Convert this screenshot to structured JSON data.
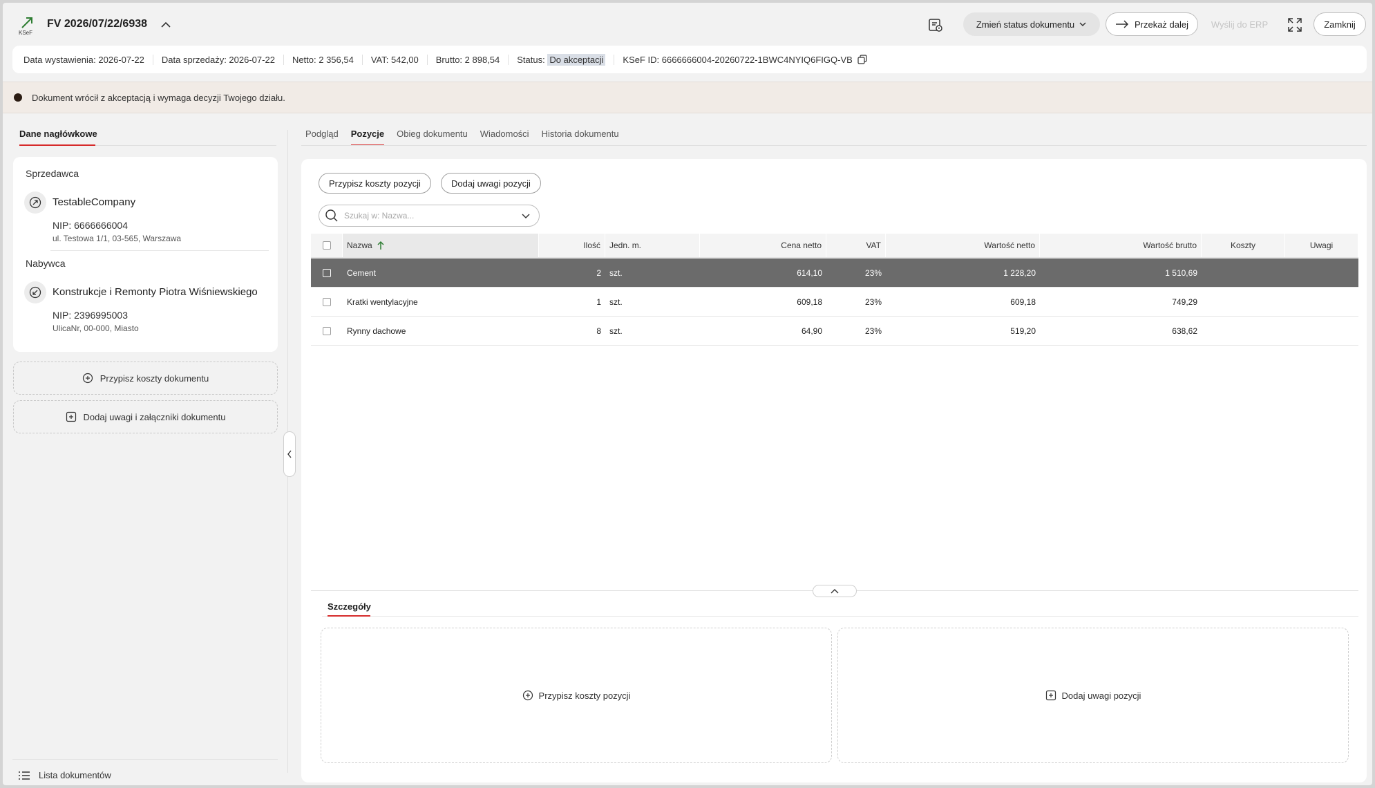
{
  "header": {
    "logo_text": "KSeF",
    "doc_title": "FV 2026/07/22/6938",
    "status_button": "Zmień status dokumentu",
    "forward_button": "Przekaż dalej",
    "erp_button": "Wyślij do ERP",
    "close_button": "Zamknij"
  },
  "info": {
    "issue_date": "Data wystawienia: 2026-07-22",
    "sale_date": "Data sprzedaży: 2026-07-22",
    "net": "Netto: 2 356,54",
    "vat": "VAT: 542,00",
    "gross": "Brutto: 2 898,54",
    "status_label": "Status:",
    "status_value": "Do akceptacji",
    "ksef_id": "KSeF ID: 6666666004-20260722-1BWC4NYIQ6FIGQ-VB"
  },
  "notice": "Dokument wrócił z akceptacją i wymaga decyzji Twojego działu.",
  "left": {
    "tab": "Dane nagłówkowe",
    "seller_label": "Sprzedawca",
    "seller_name": "TestableCompany",
    "seller_nip": "NIP: 6666666004",
    "seller_address": "ul. Testowa 1/1, 03-565, Warszawa",
    "buyer_label": "Nabywca",
    "buyer_name": "Konstrukcje i Remonty Piotra Wiśniewskiego",
    "buyer_nip": "NIP: 2396995003",
    "buyer_address": "UlicaNr, 00-000, Miasto",
    "assign_costs": "Przypisz koszty dokumentu",
    "add_notes": "Dodaj uwagi i załączniki dokumentu",
    "doc_list": "Lista dokumentów"
  },
  "tabs": [
    "Podgląd",
    "Pozycje",
    "Obieg dokumentu",
    "Wiadomości",
    "Historia dokumentu"
  ],
  "active_tab": "Pozycje",
  "main": {
    "assign_costs_btn": "Przypisz koszty pozycji",
    "add_notes_btn": "Dodaj uwagi pozycji",
    "search_placeholder": "Szukaj w: Nazwa..."
  },
  "table": {
    "columns": [
      "Nazwa",
      "Ilość",
      "Jedn. m.",
      "Cena netto",
      "VAT",
      "Wartość netto",
      "Wartość brutto",
      "Koszty",
      "Uwagi"
    ],
    "rows": [
      {
        "name": "Cement",
        "qty": "2",
        "unit": "szt.",
        "price": "614,10",
        "vat": "23%",
        "net": "1 228,20",
        "gross": "1 510,69",
        "selected": true
      },
      {
        "name": "Kratki wentylacyjne",
        "qty": "1",
        "unit": "szt.",
        "price": "609,18",
        "vat": "23%",
        "net": "609,18",
        "gross": "749,29",
        "selected": false
      },
      {
        "name": "Rynny dachowe",
        "qty": "8",
        "unit": "szt.",
        "price": "64,90",
        "vat": "23%",
        "net": "519,20",
        "gross": "638,62",
        "selected": false
      }
    ]
  },
  "details": {
    "tab": "Szczegóły",
    "assign_costs": "Przypisz koszty pozycji",
    "add_notes": "Dodaj uwagi pozycji"
  },
  "colors": {
    "accent": "#d62b2b",
    "selected_row": "#6b6b6b",
    "notice_bg": "#f1ebe6"
  }
}
